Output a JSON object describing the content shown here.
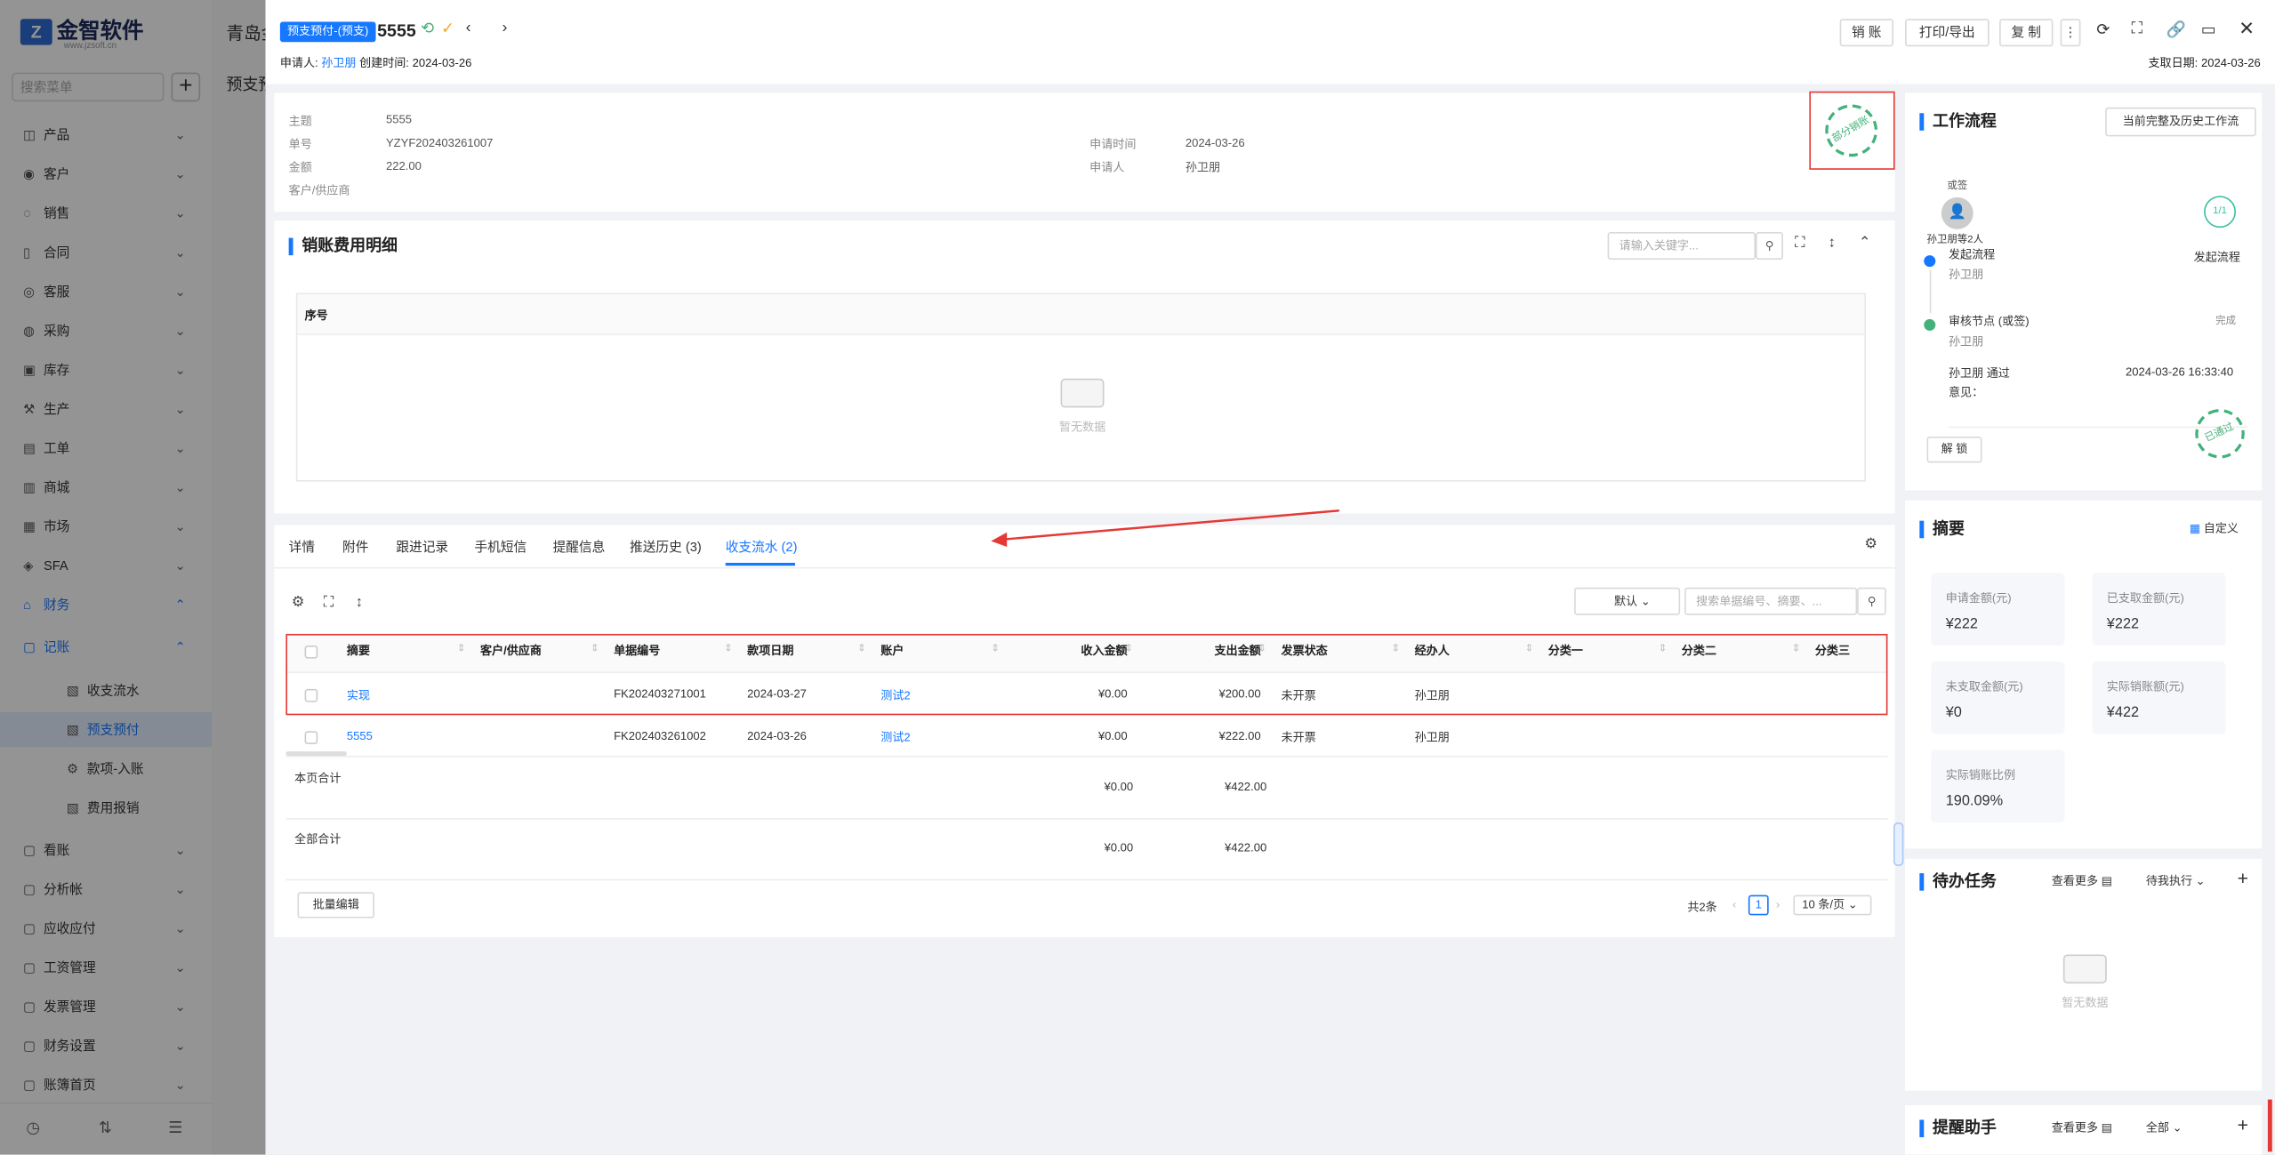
{
  "app": {
    "logo_text": "金智软件",
    "logo_sub": "www.jzsoft.cn",
    "search_placeholder": "搜索菜单",
    "bg_title": "青岛金",
    "bg_title2": "预支预"
  },
  "sidebar": {
    "items": [
      {
        "label": "产品",
        "icon": "cube-icon"
      },
      {
        "label": "客户",
        "icon": "user-icon"
      },
      {
        "label": "销售",
        "icon": "sales-icon"
      },
      {
        "label": "合同",
        "icon": "contract-icon"
      },
      {
        "label": "客服",
        "icon": "service-icon"
      },
      {
        "label": "采购",
        "icon": "cart-icon"
      },
      {
        "label": "库存",
        "icon": "warehouse-icon"
      },
      {
        "label": "生产",
        "icon": "factory-icon"
      },
      {
        "label": "工单",
        "icon": "ticket-icon"
      },
      {
        "label": "商城",
        "icon": "shop-icon"
      },
      {
        "label": "市场",
        "icon": "market-icon"
      },
      {
        "label": "SFA",
        "icon": "sfa-icon"
      },
      {
        "label": "财务",
        "icon": "finance-icon"
      },
      {
        "label": "记账",
        "icon": "ledger-icon"
      },
      {
        "label": "收支流水",
        "icon": "doc-icon"
      },
      {
        "label": "预支预付",
        "icon": "doc-icon"
      },
      {
        "label": "款项-入账",
        "icon": "gear-icon"
      },
      {
        "label": "费用报销",
        "icon": "doc-icon"
      },
      {
        "label": "看账",
        "icon": "ledger-icon"
      },
      {
        "label": "分析帐",
        "icon": "ledger-icon"
      },
      {
        "label": "应收应付",
        "icon": "ledger-icon"
      },
      {
        "label": "工资管理",
        "icon": "ledger-icon"
      },
      {
        "label": "发票管理",
        "icon": "ledger-icon"
      },
      {
        "label": "财务设置",
        "icon": "ledger-icon"
      },
      {
        "label": "账簿首页",
        "icon": "ledger-icon"
      }
    ]
  },
  "header": {
    "tag": "预支预付-(预支)",
    "title": "5555",
    "applicant_label": "申请人:",
    "applicant": "孙卫朋",
    "created_label": "创建时间:",
    "created": "2024-03-26",
    "pay_date_label": "支取日期:",
    "pay_date": "2024-03-26",
    "buttons": {
      "writeoff": "销 账",
      "print": "打印/导出",
      "copy": "复 制"
    }
  },
  "info": {
    "subject_k": "主题",
    "subject_v": "5555",
    "no_k": "单号",
    "no_v": "YZYF202403261007",
    "amount_k": "金额",
    "amount_v": "222.00",
    "cust_k": "客户/供应商",
    "apply_time_k": "申请时间",
    "apply_time_v": "2024-03-26",
    "applier_k": "申请人",
    "applier_v": "孙卫朋",
    "stamp_text": "部分销账"
  },
  "detail": {
    "title": "销账费用明细",
    "search_placeholder": "请输入关键字...",
    "col_seq": "序号",
    "empty": "暂无数据"
  },
  "tabs": [
    "详情",
    "附件",
    "跟进记录",
    "手机短信",
    "提醒信息",
    "推送历史 (3)",
    "收支流水 (2)"
  ],
  "table": {
    "default_select": "默认",
    "search_placeholder": "搜索单据编号、摘要、...",
    "headers": [
      "摘要",
      "客户/供应商",
      "单据编号",
      "款项日期",
      "账户",
      "收入金额",
      "支出金额",
      "发票状态",
      "经办人",
      "分类一",
      "分类二",
      "分类三"
    ],
    "rows": [
      {
        "summary": "实现",
        "customer": "",
        "no": "FK202403271001",
        "date": "2024-03-27",
        "account": "测试2",
        "income": "¥0.00",
        "expense": "¥200.00",
        "invoice": "未开票",
        "handler": "孙卫朋"
      },
      {
        "summary": "5555",
        "customer": "",
        "no": "FK202403261002",
        "date": "2024-03-26",
        "account": "测试2",
        "income": "¥0.00",
        "expense": "¥222.00",
        "invoice": "未开票",
        "handler": "孙卫朋"
      }
    ],
    "page_total_label": "本页合计",
    "page_total_income": "¥0.00",
    "page_total_expense": "¥422.00",
    "all_total_label": "全部合计",
    "all_total_income": "¥0.00",
    "all_total_expense": "¥422.00",
    "batch_edit": "批量编辑",
    "total_count": "共2条",
    "page": "1",
    "page_size": "10 条/页"
  },
  "workflow": {
    "title": "工作流程",
    "history_btn": "当前完整及历史工作流",
    "sign_label": "或签",
    "signer": "孙卫朋等2人",
    "progress": "1/1",
    "start_label": "发起流程",
    "start_label_right": "发起流程",
    "starter": "孙卫朋",
    "node_label": "审核节点 (或签)",
    "node_user": "孙卫朋",
    "node_status": "完成",
    "pass_text": "孙卫朋 通过",
    "pass_time": "2024-03-26 16:33:40",
    "opinion": "意见：",
    "unlock": "解 锁",
    "approved_stamp": "已通过"
  },
  "summary": {
    "title": "摘要",
    "custom": "自定义",
    "items": [
      {
        "label": "申请金额(元)",
        "value": "¥222"
      },
      {
        "label": "已支取金额(元)",
        "value": "¥222"
      },
      {
        "label": "未支取金额(元)",
        "value": "¥0"
      },
      {
        "label": "实际销账额(元)",
        "value": "¥422"
      },
      {
        "label": "实际销账比例",
        "value": "190.09%"
      }
    ]
  },
  "todo": {
    "title": "待办任务",
    "more": "查看更多",
    "filter": "待我执行",
    "empty": "暂无数据"
  },
  "reminder": {
    "title": "提醒助手",
    "more": "查看更多",
    "filter": "全部"
  }
}
